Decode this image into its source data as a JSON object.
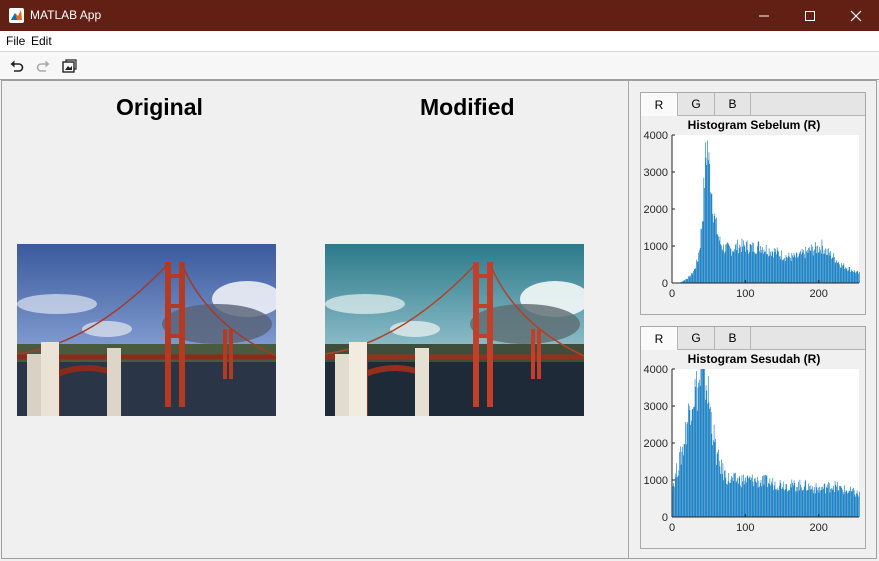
{
  "window": {
    "title": "MATLAB App"
  },
  "menu": {
    "file": "File",
    "edit": "Edit"
  },
  "labels": {
    "original": "Original",
    "modified": "Modified"
  },
  "tabs": [
    "R",
    "G",
    "B"
  ],
  "colors": {
    "titlebar": "#621f14",
    "bars": "#0072bd"
  },
  "chart_data": [
    {
      "type": "bar",
      "title": "Histogram Sebelum (R)",
      "xlim": [
        0,
        255
      ],
      "ylim": [
        0,
        4000
      ],
      "xticks": [
        0,
        100,
        200
      ],
      "yticks": [
        0,
        1000,
        2000,
        3000,
        4000
      ],
      "points": [
        [
          0,
          0
        ],
        [
          10,
          0
        ],
        [
          15,
          60
        ],
        [
          20,
          120
        ],
        [
          25,
          200
        ],
        [
          30,
          350
        ],
        [
          35,
          650
        ],
        [
          38,
          1100
        ],
        [
          42,
          2000
        ],
        [
          45,
          3300
        ],
        [
          48,
          3700
        ],
        [
          50,
          3200
        ],
        [
          53,
          2700
        ],
        [
          56,
          2000
        ],
        [
          60,
          1500
        ],
        [
          65,
          1100
        ],
        [
          70,
          950
        ],
        [
          80,
          900
        ],
        [
          90,
          1000
        ],
        [
          100,
          1000
        ],
        [
          110,
          950
        ],
        [
          120,
          1000
        ],
        [
          130,
          900
        ],
        [
          140,
          850
        ],
        [
          150,
          750
        ],
        [
          160,
          700
        ],
        [
          170,
          700
        ],
        [
          180,
          800
        ],
        [
          190,
          900
        ],
        [
          200,
          950
        ],
        [
          205,
          1000
        ],
        [
          210,
          850
        ],
        [
          220,
          700
        ],
        [
          230,
          500
        ],
        [
          240,
          400
        ],
        [
          250,
          300
        ],
        [
          255,
          250
        ]
      ]
    },
    {
      "type": "bar",
      "title": "Histogram Sesudah (R)",
      "xlim": [
        0,
        255
      ],
      "ylim": [
        0,
        4000
      ],
      "xticks": [
        0,
        100,
        200
      ],
      "yticks": [
        0,
        1000,
        2000,
        3000,
        4000
      ],
      "points": [
        [
          0,
          800
        ],
        [
          3,
          1000
        ],
        [
          7,
          1300
        ],
        [
          11,
          1600
        ],
        [
          15,
          1900
        ],
        [
          19,
          2400
        ],
        [
          23,
          2900
        ],
        [
          27,
          3300
        ],
        [
          31,
          3400
        ],
        [
          35,
          3500
        ],
        [
          39,
          3700
        ],
        [
          43,
          3800
        ],
        [
          47,
          3600
        ],
        [
          51,
          3000
        ],
        [
          55,
          2400
        ],
        [
          60,
          1700
        ],
        [
          65,
          1400
        ],
        [
          70,
          1200
        ],
        [
          75,
          1050
        ],
        [
          80,
          1000
        ],
        [
          90,
          1000
        ],
        [
          100,
          1000
        ],
        [
          110,
          1000
        ],
        [
          120,
          950
        ],
        [
          130,
          950
        ],
        [
          140,
          900
        ],
        [
          150,
          900
        ],
        [
          160,
          850
        ],
        [
          170,
          850
        ],
        [
          180,
          850
        ],
        [
          190,
          800
        ],
        [
          200,
          750
        ],
        [
          210,
          800
        ],
        [
          220,
          850
        ],
        [
          230,
          750
        ],
        [
          240,
          700
        ],
        [
          250,
          650
        ],
        [
          255,
          600
        ]
      ]
    }
  ]
}
